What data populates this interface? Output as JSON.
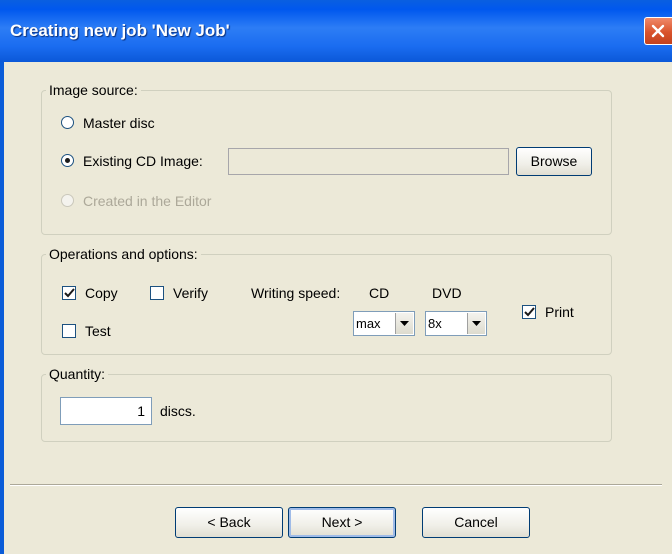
{
  "window": {
    "title": "Creating new job 'New Job'"
  },
  "image_source": {
    "legend": "Image source:",
    "master_disc_label": "Master disc",
    "existing_image_label": "Existing CD Image:",
    "existing_image_path": "",
    "browse_label": "Browse",
    "editor_label": "Created in the Editor",
    "selected": "existing_cd_image"
  },
  "operations": {
    "legend": "Operations and options:",
    "copy_label": "Copy",
    "copy_checked": true,
    "verify_label": "Verify",
    "verify_checked": false,
    "test_label": "Test",
    "test_checked": false,
    "writing_speed_label": "Writing speed:",
    "cd_label": "CD",
    "dvd_label": "DVD",
    "cd_speed": "max",
    "dvd_speed": "8x",
    "print_label": "Print",
    "print_checked": true
  },
  "quantity": {
    "legend": "Quantity:",
    "value": "1",
    "unit": "discs."
  },
  "footer": {
    "back_label": "< Back",
    "next_label": "Next >",
    "cancel_label": "Cancel"
  }
}
